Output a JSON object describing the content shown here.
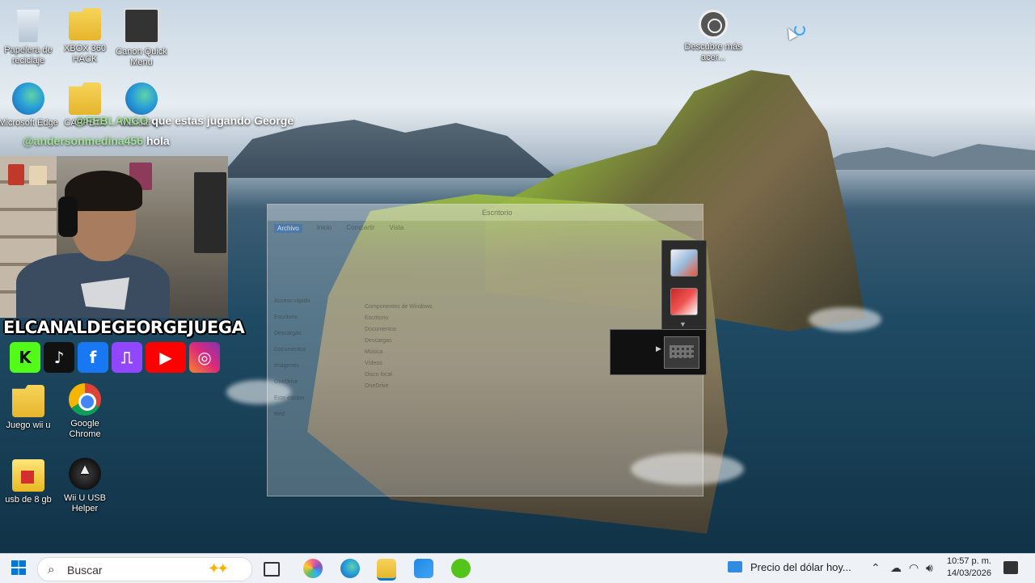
{
  "desktop": {
    "icons": [
      {
        "label": "Papelera de reciclaje",
        "icon": "recycle-bin-icon"
      },
      {
        "label": "XBOX 360 HACK",
        "icon": "folder-icon"
      },
      {
        "label": "Canon Quick Menu",
        "icon": "canon-icon"
      },
      {
        "label": "Microsoft Edge",
        "icon": "edge-icon"
      },
      {
        "label": "CARPETA",
        "icon": "folder-icon"
      },
      {
        "label": "Manual en",
        "icon": "edge-icon"
      },
      {
        "label": "Descubre más acer...",
        "icon": "discover-icon"
      },
      {
        "label": "Juego wii u",
        "icon": "folder-icon"
      },
      {
        "label": "Google Chrome",
        "icon": "chrome-icon"
      },
      {
        "label": "usb de 8 gb",
        "icon": "usb-folder-icon"
      },
      {
        "label": "Wii U USB Helper",
        "icon": "rocket-icon"
      }
    ]
  },
  "chat": [
    {
      "user": "@FEBLANCO",
      "message": "que estas jugando George"
    },
    {
      "user": "@andersonmedina456",
      "message": "hola"
    }
  ],
  "overlay": {
    "channel_name": "ELCANALDEGEORGEJUEGA",
    "socials": [
      {
        "name": "kick",
        "glyph": "K",
        "color": "#53fc18"
      },
      {
        "name": "tiktok",
        "glyph": "♪",
        "color": "#111111"
      },
      {
        "name": "facebook",
        "glyph": "f",
        "color": "#1877f2"
      },
      {
        "name": "twitch",
        "glyph": "⎍",
        "color": "#9146ff"
      },
      {
        "name": "youtube",
        "glyph": "▶",
        "color": "#ff0000"
      },
      {
        "name": "instagram",
        "glyph": "◎",
        "color": "#c13584"
      }
    ]
  },
  "ghost_window": {
    "title": "Escritorio",
    "tabs": [
      "Archivo",
      "Inicio",
      "Compartir",
      "Vista"
    ],
    "sidebar": [
      "Acceso rápido",
      "Escritorio",
      "Descargas",
      "Documentos",
      "Imágenes",
      "OneDrive",
      "Este equipo",
      "Red"
    ],
    "items": [
      "Componentes de Windows",
      "Escritorio",
      "Documentos",
      "Descargas",
      "Música",
      "Vídeos",
      "Disco local",
      "OneDrive"
    ]
  },
  "taskbar": {
    "search_placeholder": "Buscar",
    "weather_text": "Precio del dólar hoy...",
    "time": "10:57 p. m.",
    "date": "14/03/2026",
    "accent": "#0078d4"
  }
}
